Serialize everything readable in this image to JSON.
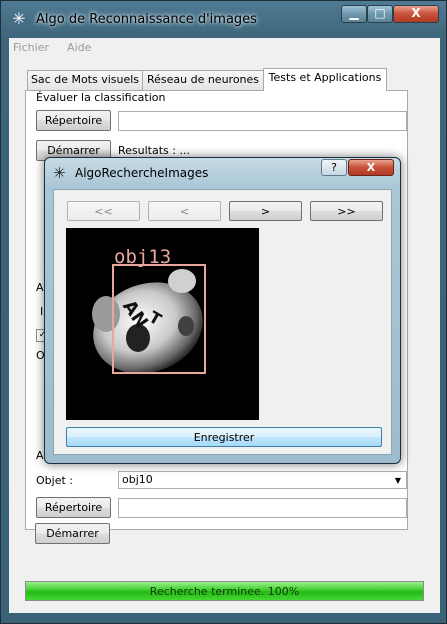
{
  "window": {
    "title": "Algo de Reconnaissance d'images",
    "app_icon": "asterisk-app-icon",
    "controls": {
      "minimize": "▁",
      "maximize": "□",
      "close": "X"
    }
  },
  "menu": {
    "items": [
      "Fichier",
      "Aide"
    ]
  },
  "tabs": [
    {
      "label": "Sac de Mots visuels"
    },
    {
      "label": "Réseau de neurones"
    },
    {
      "label": "Tests et Applications"
    }
  ],
  "panel": {
    "section1_title": "Évaluer la classification",
    "repertoire_label": "Répertoire",
    "demarrer_label": "Démarrer",
    "resultats_text": "Resultats : ...",
    "partial_labels": [
      "Ap",
      "Ir",
      "Obj",
      "Ap"
    ],
    "objet_label": "Objet :",
    "objet_value": "obj10",
    "repertoire2_label": "Répertoire",
    "demarrer2_label": "Démarrer"
  },
  "status": {
    "text": "Recherche terminee. 100%",
    "progress": 1.0
  },
  "dialog": {
    "title": "AlgoRechercheImages",
    "help": "?",
    "close": "X",
    "nav": {
      "first": "<<",
      "prev": "<",
      "next": ">",
      "last": ">>"
    },
    "detection_label": "obj13",
    "save_label": "Enregistrer"
  },
  "colors": {
    "progress_green": "#2fc41f",
    "detection_box": "#e8a79a"
  }
}
